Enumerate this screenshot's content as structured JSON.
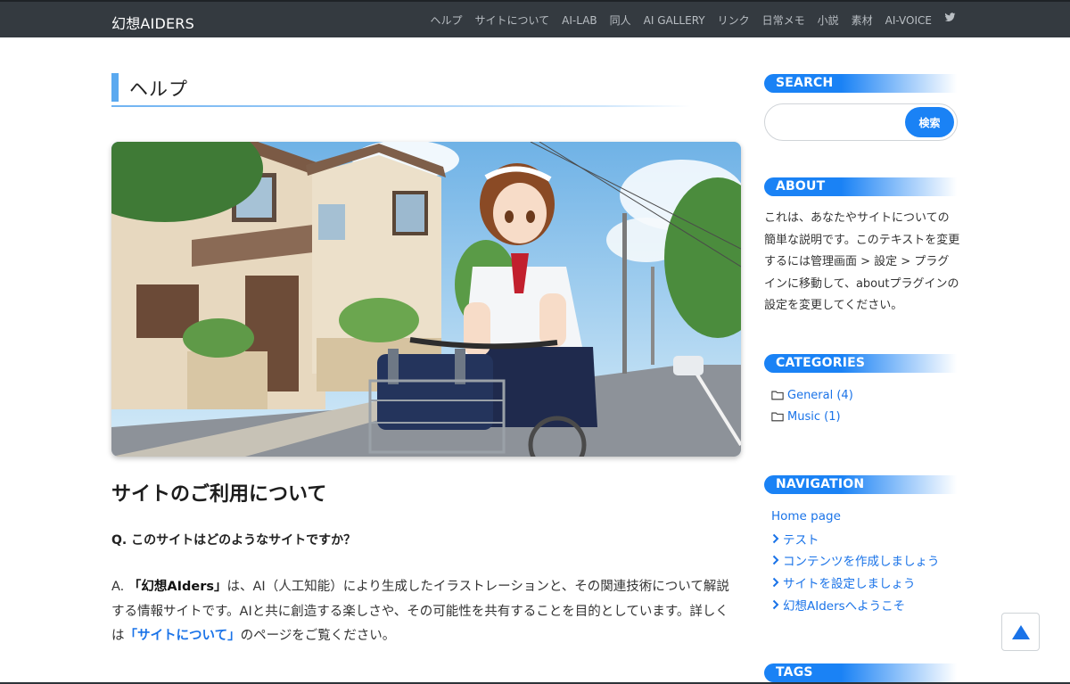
{
  "brand": "幻想AIDERS",
  "nav": {
    "links": [
      "ヘルプ",
      "サイトについて",
      "AI-LAB",
      "同人",
      "AI GALLERY",
      "リンク",
      "日常メモ",
      "小説",
      "素材",
      "AI-VOICE"
    ],
    "twitter_icon": "twitter-icon"
  },
  "page": {
    "heading": "ヘルプ",
    "section_title": "サイトのご利用について",
    "question": "Q. このサイトはどのようなサイトですか？",
    "answer": {
      "prefix": "A. ",
      "brand_quote": "「幻想AIders」",
      "body": "は、AI（人工知能）により生成したイラストレーションと、その関連技術について解説する情報サイトです。AIと共に創造する楽しさや、その可能性を共有することを目的としています。詳しくは",
      "link": "「サイトについて」",
      "suffix": "のページをご覧ください。"
    }
  },
  "sidebar": {
    "search": {
      "title": "SEARCH",
      "button": "検索",
      "placeholder": ""
    },
    "about": {
      "title": "ABOUT",
      "text": "これは、あなたやサイトについての簡単な説明です。このテキストを変更するには管理画面 > 設定 > プラグインに移動して、aboutプラグインの設定を変更してください。"
    },
    "categories": {
      "title": "CATEGORIES",
      "items": [
        "General (4)",
        "Music (1)"
      ]
    },
    "navigation": {
      "title": "NAVIGATION",
      "home": "Home page",
      "items": [
        "テスト",
        "コンテンツを作成しましょう",
        "サイトを設定しましょう",
        "幻想AIdersへようこそ"
      ]
    },
    "tags": {
      "title": "TAGS"
    }
  },
  "colors": {
    "navbar": "#343a40",
    "accent": "#1a82f5",
    "link": "#1a73e8",
    "heading_bar": "#5aa9f0"
  },
  "icons": {
    "folder": "folder-icon",
    "chevron": "chevron-right-icon",
    "to_top": "arrow-up-icon"
  }
}
